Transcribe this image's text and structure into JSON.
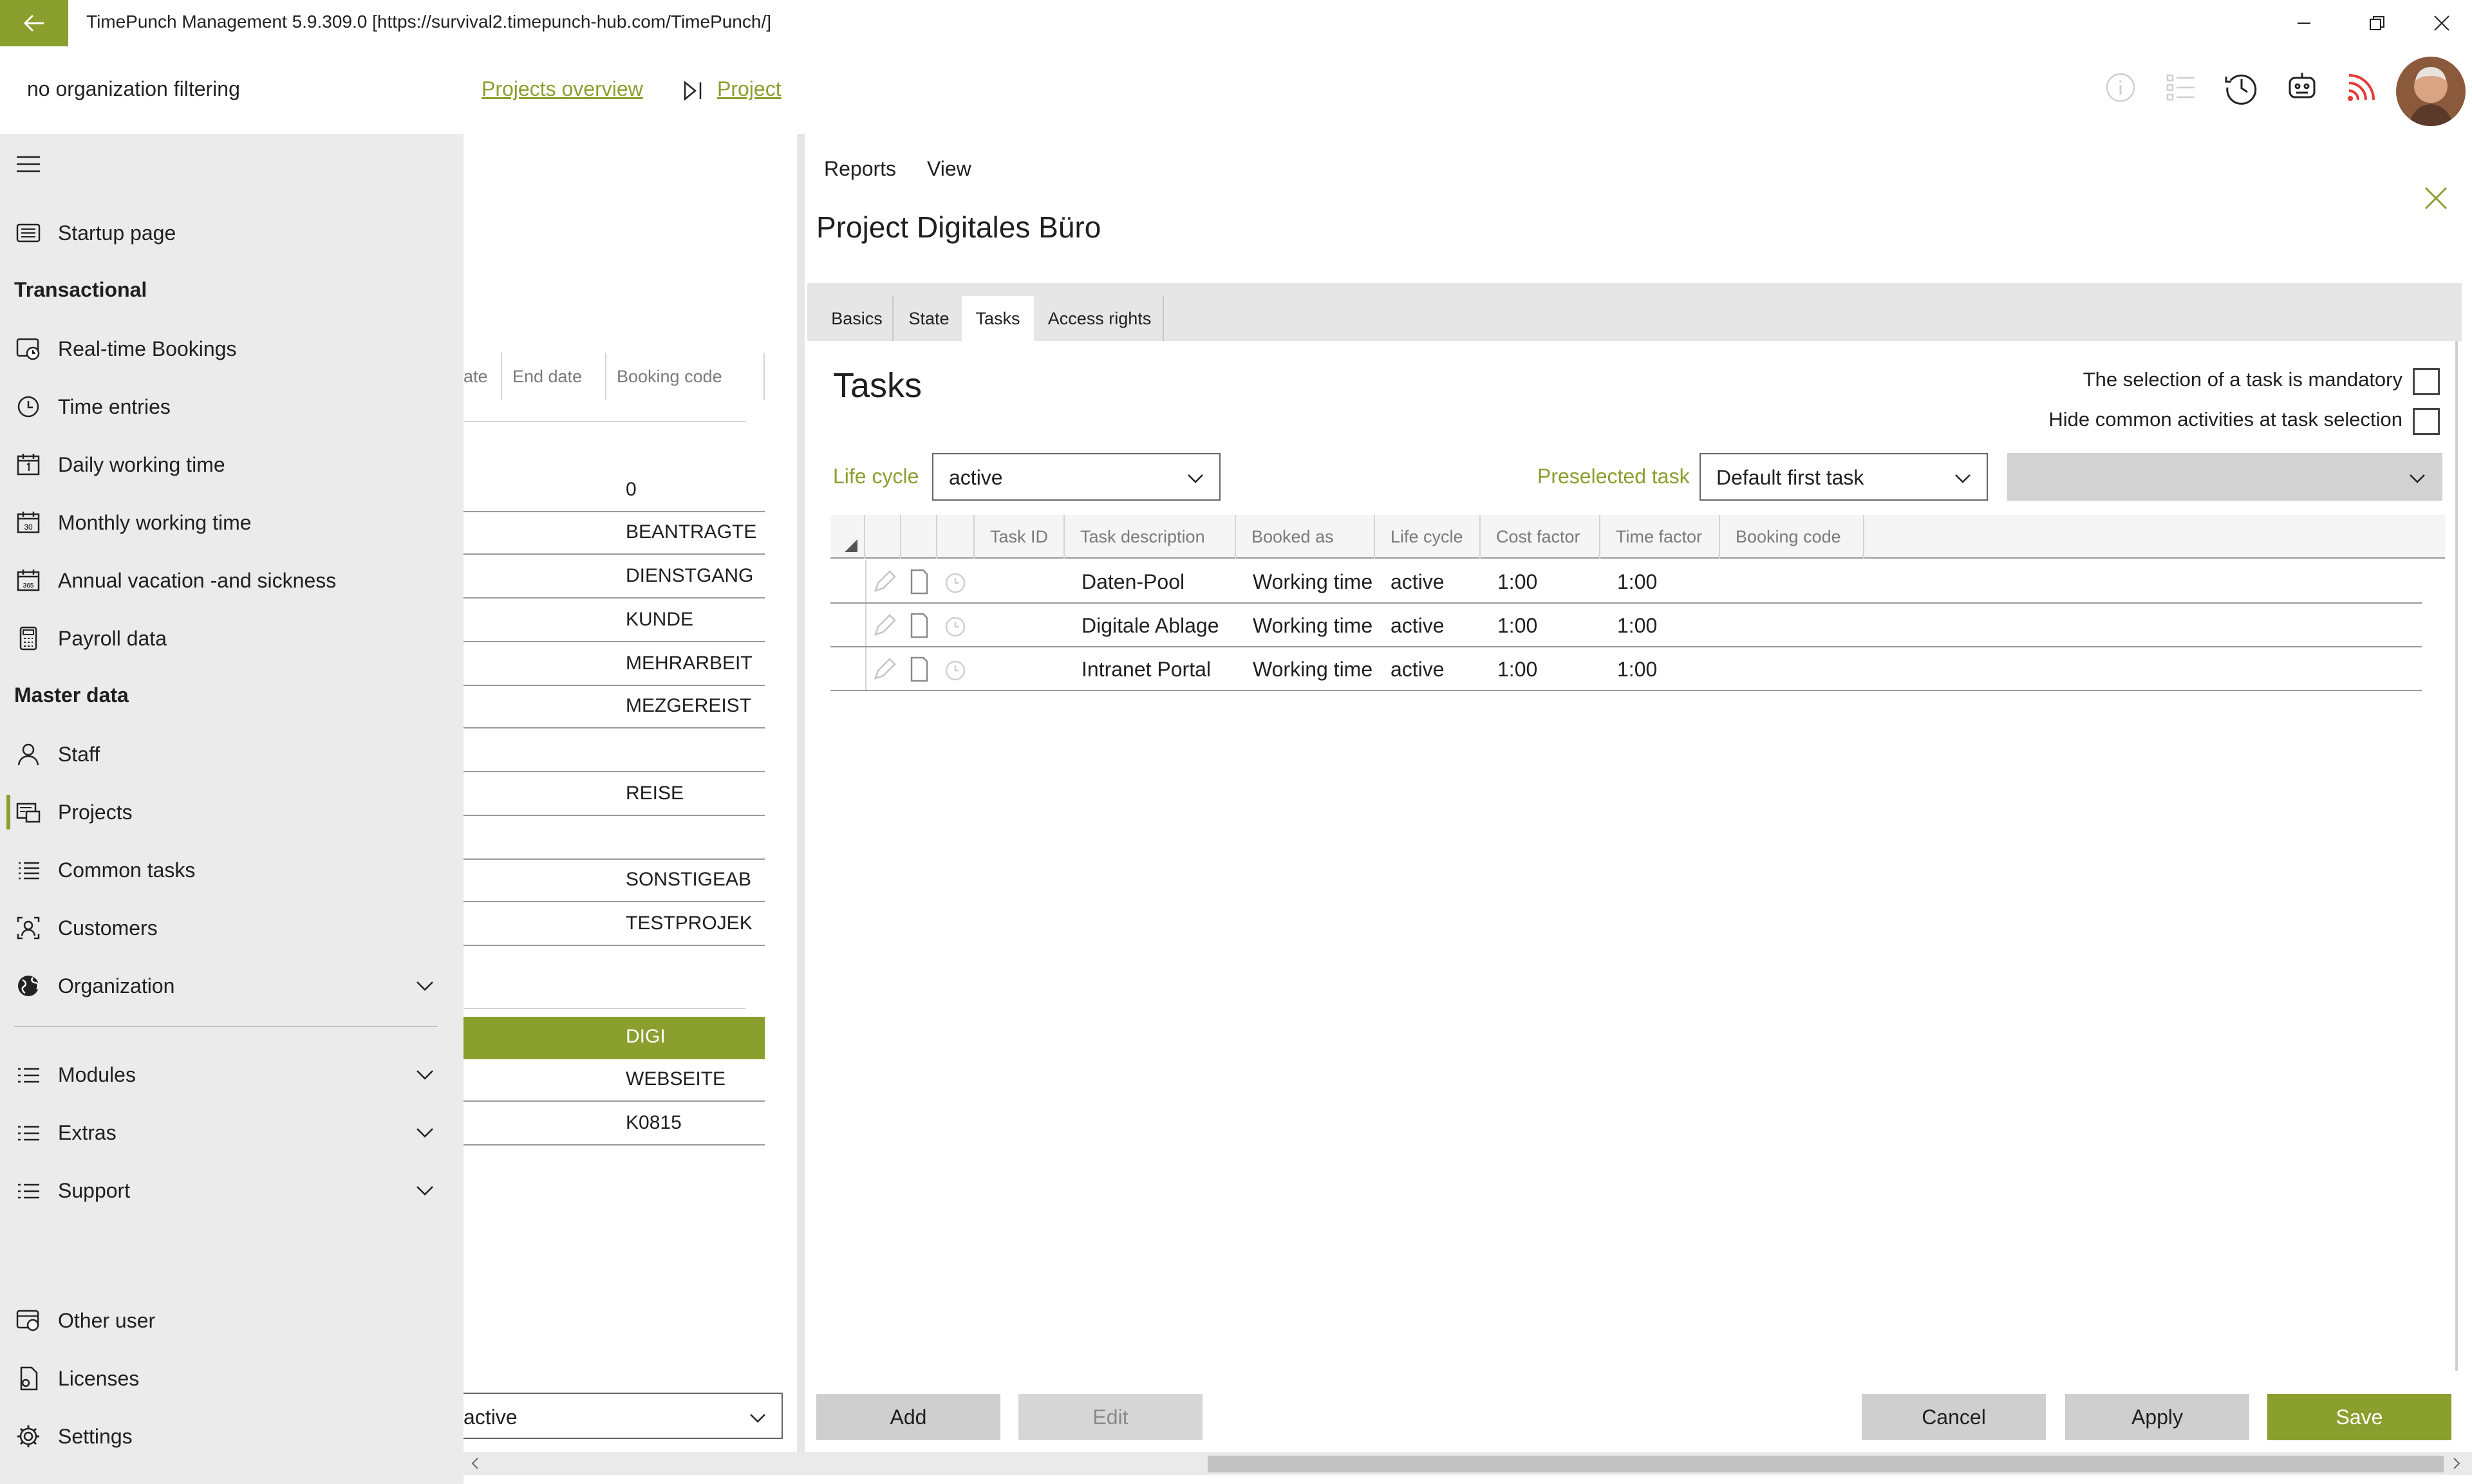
{
  "titlebar": {
    "title": "TimePunch Management 5.9.309.0 [https://survival2.timepunch-hub.com/TimePunch/]"
  },
  "header": {
    "org_filter": "no organization filtering",
    "projects_overview": "Projects overview",
    "project_link": "Project"
  },
  "sidebar": {
    "items": [
      {
        "label": "Startup page",
        "icon": "startup-page-icon"
      },
      {
        "label": "Transactional",
        "heading": true
      },
      {
        "label": "Real-time Bookings",
        "icon": "realtime-bookings-icon"
      },
      {
        "label": "Time entries",
        "icon": "clock-icon"
      },
      {
        "label": "Daily working time",
        "icon": "calendar-day-icon"
      },
      {
        "label": "Monthly working time",
        "icon": "calendar-month-icon"
      },
      {
        "label": "Annual vacation -and sickness",
        "icon": "calendar-year-icon"
      },
      {
        "label": "Payroll data",
        "icon": "calculator-icon"
      },
      {
        "label": "Master data",
        "heading": true
      },
      {
        "label": "Staff",
        "icon": "person-icon"
      },
      {
        "label": "Projects",
        "icon": "projects-icon",
        "selected": true
      },
      {
        "label": "Common tasks",
        "icon": "list-icon"
      },
      {
        "label": "Customers",
        "icon": "customers-icon"
      },
      {
        "label": "Organization",
        "icon": "globe-icon"
      },
      {
        "label": "Modules",
        "icon": "modules-icon"
      },
      {
        "label": "Extras",
        "icon": "extras-icon"
      },
      {
        "label": "Support",
        "icon": "support-icon"
      },
      {
        "label": "Other user",
        "icon": "other-user-icon"
      },
      {
        "label": "Licenses",
        "icon": "licenses-icon"
      },
      {
        "label": "Settings",
        "icon": "gear-icon"
      }
    ]
  },
  "middle": {
    "columns": [
      "ate",
      "End date",
      "Booking code"
    ],
    "rows": [
      "0",
      "BEANTRAGTE",
      "DIENSTGANG",
      "KUNDE",
      "MEHRARBEIT",
      "MEZGEREIST",
      "",
      "REISE",
      "",
      "SONSTIGEAB",
      "TESTPROJEK",
      "",
      "DIGI",
      "WEBSEITE",
      "K0815"
    ],
    "selected_row": "DIGI",
    "filter_value": "active"
  },
  "right": {
    "menu": [
      "Reports",
      "View"
    ],
    "project_title": "Project Digitales Büro",
    "tabs": [
      "Basics",
      "State",
      "Tasks",
      "Access rights"
    ],
    "active_tab": "Tasks",
    "section_title": "Tasks",
    "mandatory_label": "The selection of a task is mandatory",
    "hide_common_label": "Hide common activities at task selection",
    "lifecycle_label": "Life cycle",
    "lifecycle_value": "active",
    "preselected_label": "Preselected task",
    "preselected_value": "Default first task",
    "grid_columns": [
      "Task ID",
      "Task description",
      "Booked as",
      "Life cycle",
      "Cost factor",
      "Time factor",
      "Booking code"
    ],
    "grid_rows": [
      {
        "task_id": "",
        "description": "Daten-Pool",
        "booked_as": "Working time",
        "life_cycle": "active",
        "cost_factor": "1:00",
        "time_factor": "1:00",
        "booking_code": ""
      },
      {
        "task_id": "",
        "description": "Digitale Ablage",
        "booked_as": "Working time",
        "life_cycle": "active",
        "cost_factor": "1:00",
        "time_factor": "1:00",
        "booking_code": ""
      },
      {
        "task_id": "",
        "description": "Intranet Portal",
        "booked_as": "Working time",
        "life_cycle": "active",
        "cost_factor": "1:00",
        "time_factor": "1:00",
        "booking_code": ""
      }
    ],
    "buttons": {
      "add": "Add",
      "edit": "Edit",
      "cancel": "Cancel",
      "apply": "Apply",
      "save": "Save"
    }
  },
  "colors": {
    "accent": "#8a9f2e",
    "sidebar_bg": "#ebebeb",
    "rss": "#e53935"
  }
}
